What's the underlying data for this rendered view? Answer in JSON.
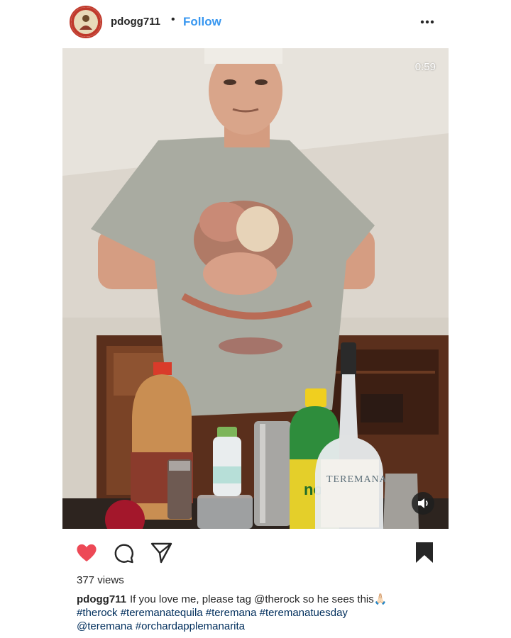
{
  "post": {
    "username": "pdogg711",
    "separator": "•",
    "follow_label": "Follow"
  },
  "video": {
    "duration": "0:59",
    "bottle_label_text": "TEREMANA",
    "lime_label_text": "no"
  },
  "icons": {
    "more": "more-options-icon",
    "like": "heart-icon",
    "comment": "comment-icon",
    "share": "share-icon",
    "save": "bookmark-icon",
    "sound": "speaker-icon"
  },
  "colors": {
    "follow": "#3897f0",
    "like_active": "#ed4956",
    "hashtag": "#002e5c"
  },
  "stats": {
    "views": "377 views"
  },
  "caption": {
    "username": "pdogg711",
    "line1_text": "If you love me, please tag @therock so he sees this🙏🏻",
    "line2_text": "#therock #teremanatequila #teremana #teremanatuesday",
    "line3_text": "@teremana #orchardapplemanarita"
  }
}
